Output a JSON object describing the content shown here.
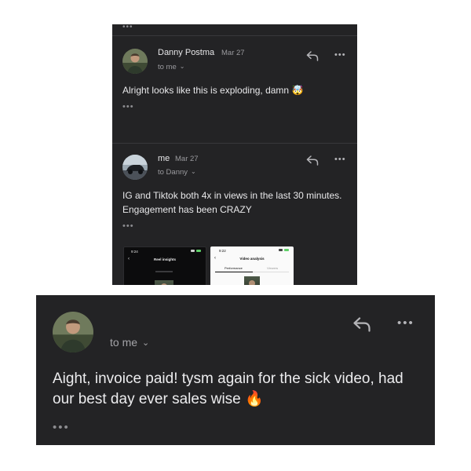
{
  "thread": {
    "messages": [
      {
        "sender": "Danny Postma",
        "date": "Mar 27",
        "recipient": "to me",
        "body": "Alright looks like this is exploding, damn",
        "emoji": "🤯"
      },
      {
        "sender": "me",
        "date": "Mar 27",
        "recipient": "to Danny",
        "body": "IG and Tiktok both 4x in views in the last 30 minutes. Engagement has been CRAZY",
        "attachments": [
          {
            "time": "9:24",
            "title": "Reel insights",
            "theme": "dark"
          },
          {
            "time": "9:22",
            "title": "Video analysis",
            "tabs": [
              "Performance",
              "Viewers"
            ],
            "theme": "light"
          }
        ]
      }
    ]
  },
  "reply": {
    "recipient": "to me",
    "body": "Aight, invoice paid! tysm again for the sick video, had our best day ever sales wise",
    "emoji": "🔥"
  },
  "icons": {
    "reply": "reply-arrow-icon",
    "more": "more-options-icon",
    "chevron": "chevron-down-icon"
  },
  "colors": {
    "panel_bg": "#232325",
    "text_primary": "#e8e8ea",
    "text_secondary": "#9a9a9e"
  }
}
